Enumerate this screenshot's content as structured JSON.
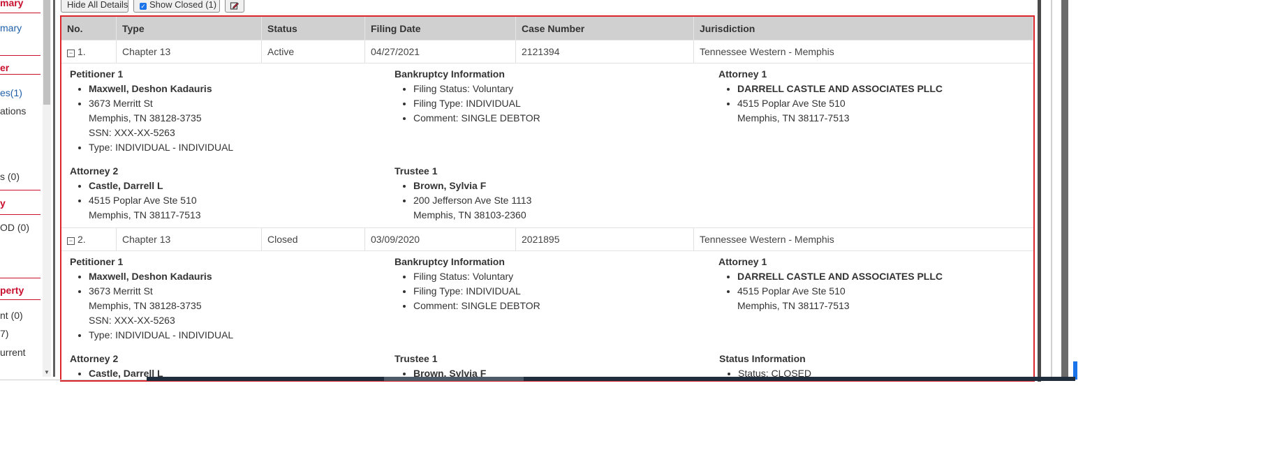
{
  "nav": {
    "items": [
      {
        "text": "mary",
        "kind": "heading"
      },
      {
        "text": "mary",
        "kind": "link"
      },
      {
        "text": "er",
        "kind": "heading"
      },
      {
        "text": "es(1)",
        "kind": "link"
      },
      {
        "text": "ations",
        "kind": "plain"
      },
      {
        "text": "s (0)",
        "kind": "plain"
      },
      {
        "text": "y",
        "kind": "heading"
      },
      {
        "text": "OD (0)",
        "kind": "plain"
      },
      {
        "text": "perty",
        "kind": "heading"
      },
      {
        "text": "nt (0)",
        "kind": "plain"
      },
      {
        "text": "7)",
        "kind": "plain"
      },
      {
        "text": "urrent",
        "kind": "plain"
      }
    ]
  },
  "toolbar": {
    "hide_label": "Hide All Details",
    "show_closed_label": "Show Closed (1)",
    "show_closed_checked": true,
    "edit_icon": "edit-icon"
  },
  "table": {
    "headers": [
      "No.",
      "Type",
      "Status",
      "Filing Date",
      "Case Number",
      "Jurisdiction"
    ],
    "cases": [
      {
        "no": "1.",
        "type": "Chapter 13",
        "status": "Active",
        "filing_date": "04/27/2021",
        "case_number": "2121394",
        "jurisdiction": "Tennessee Western - Memphis",
        "petitioner": {
          "title": "Petitioner 1",
          "name": "Maxwell, Deshon Kadauris",
          "addr1": "3673 Merritt St",
          "addr2": "Memphis, TN 38128-3735",
          "ssn": "SSN: XXX-XX-5263",
          "type": "Type: INDIVIDUAL - INDIVIDUAL"
        },
        "bankruptcy": {
          "title": "Bankruptcy Information",
          "filing_status": "Filing Status: Voluntary",
          "filing_type": "Filing Type: INDIVIDUAL",
          "comment": "Comment: SINGLE DEBTOR"
        },
        "attorney1": {
          "title": "Attorney 1",
          "name": "DARRELL CASTLE AND ASSOCIATES PLLC",
          "addr1": "4515 Poplar Ave Ste 510",
          "addr2": "Memphis, TN 38117-7513"
        },
        "attorney2": {
          "title": "Attorney 2",
          "name": "Castle, Darrell L",
          "addr1": "4515 Poplar Ave Ste 510",
          "addr2": "Memphis, TN 38117-7513"
        },
        "trustee": {
          "title": "Trustee 1",
          "name": "Brown, Sylvia F",
          "addr1": "200 Jefferson Ave Ste 1113",
          "addr2": "Memphis, TN 38103-2360"
        }
      },
      {
        "no": "2.",
        "type": "Chapter 13",
        "status": "Closed",
        "filing_date": "03/09/2020",
        "case_number": "2021895",
        "jurisdiction": "Tennessee Western - Memphis",
        "petitioner": {
          "title": "Petitioner 1",
          "name": "Maxwell, Deshon Kadauris",
          "addr1": "3673 Merritt St",
          "addr2": "Memphis, TN 38128-3735",
          "ssn": "SSN: XXX-XX-5263",
          "type": "Type: INDIVIDUAL - INDIVIDUAL"
        },
        "bankruptcy": {
          "title": "Bankruptcy Information",
          "filing_status": "Filing Status: Voluntary",
          "filing_type": "Filing Type: INDIVIDUAL",
          "comment": "Comment: SINGLE DEBTOR"
        },
        "attorney1": {
          "title": "Attorney 1",
          "name": "DARRELL CASTLE AND ASSOCIATES PLLC",
          "addr1": "4515 Poplar Ave Ste 510",
          "addr2": "Memphis, TN 38117-7513"
        },
        "attorney2": {
          "title": "Attorney 2",
          "name": "Castle, Darrell L"
        },
        "trustee": {
          "title": "Trustee 1",
          "name": "Brown, Sylvia F"
        },
        "status_info": {
          "title": "Status Information",
          "status": "Status: CLOSED"
        }
      }
    ]
  },
  "colors": {
    "accent_red": "#d9262d",
    "link_blue": "#1f5fa8",
    "header_gray": "#d0d0d0"
  }
}
